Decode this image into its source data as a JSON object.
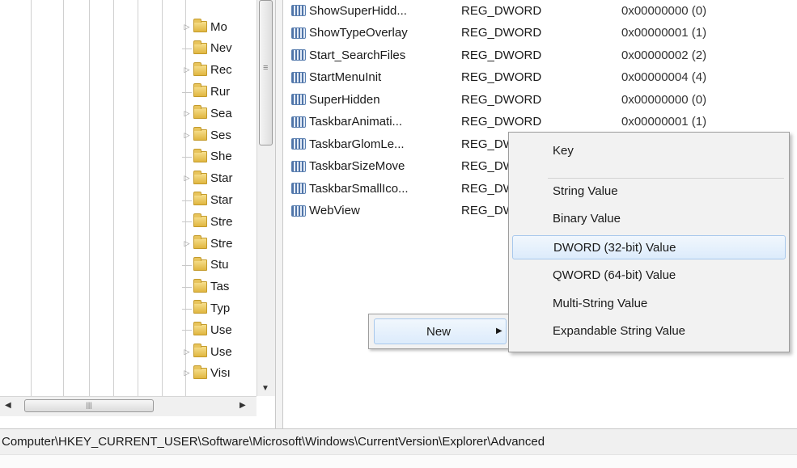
{
  "tree": {
    "items": [
      {
        "label": "Mo",
        "expandable": true
      },
      {
        "label": "Nev",
        "expandable": false
      },
      {
        "label": "Rec",
        "expandable": true
      },
      {
        "label": "Rur",
        "expandable": false
      },
      {
        "label": "Sea",
        "expandable": true
      },
      {
        "label": "Ses",
        "expandable": true
      },
      {
        "label": "She",
        "expandable": false
      },
      {
        "label": "Star",
        "expandable": true
      },
      {
        "label": "Star",
        "expandable": false
      },
      {
        "label": "Stre",
        "expandable": false
      },
      {
        "label": "Stre",
        "expandable": true
      },
      {
        "label": "Stu",
        "expandable": false
      },
      {
        "label": "Tas",
        "expandable": false
      },
      {
        "label": "Typ",
        "expandable": false
      },
      {
        "label": "Use",
        "expandable": false
      },
      {
        "label": "Use",
        "expandable": true
      },
      {
        "label": "Visı",
        "expandable": true
      }
    ]
  },
  "values": {
    "rows": [
      {
        "name": "ShowSuperHidd...",
        "type": "REG_DWORD",
        "data": "0x00000000 (0)"
      },
      {
        "name": "ShowTypeOverlay",
        "type": "REG_DWORD",
        "data": "0x00000001 (1)"
      },
      {
        "name": "Start_SearchFiles",
        "type": "REG_DWORD",
        "data": "0x00000002 (2)"
      },
      {
        "name": "StartMenuInit",
        "type": "REG_DWORD",
        "data": "0x00000004 (4)"
      },
      {
        "name": "SuperHidden",
        "type": "REG_DWORD",
        "data": "0x00000000 (0)"
      },
      {
        "name": "TaskbarAnimati...",
        "type": "REG_DWORD",
        "data": "0x00000001 (1)"
      },
      {
        "name": "TaskbarGlomLe...",
        "type": "REG_DW",
        "data": ""
      },
      {
        "name": "TaskbarSizeMove",
        "type": "REG_DW",
        "data": ""
      },
      {
        "name": "TaskbarSmallIco...",
        "type": "REG_DW",
        "data": ""
      },
      {
        "name": "WebView",
        "type": "REG_DW",
        "data": ""
      }
    ]
  },
  "context_menu": {
    "new_label": "New",
    "submenu": [
      "Key",
      "String Value",
      "Binary Value",
      "DWORD (32-bit) Value",
      "QWORD (64-bit) Value",
      "Multi-String Value",
      "Expandable String Value"
    ],
    "highlighted": "DWORD (32-bit) Value"
  },
  "status": {
    "path": "Computer\\HKEY_CURRENT_USER\\Software\\Microsoft\\Windows\\CurrentVersion\\Explorer\\Advanced"
  },
  "colors": {
    "highlight_border": "#a8c8ec",
    "highlight_fill": "#dcebfb",
    "folder": "#e0b640"
  }
}
